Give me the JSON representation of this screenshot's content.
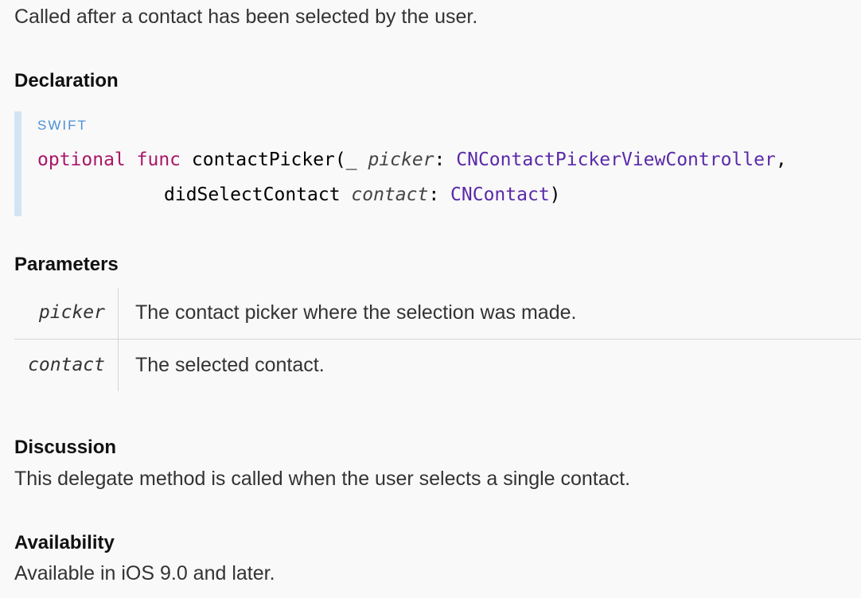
{
  "summary": "Called after a contact has been selected by the user.",
  "declaration": {
    "heading": "Declaration",
    "language": "SWIFT",
    "line1": {
      "kw_optional": "optional",
      "kw_func": "func",
      "method": "contactPicker(_ ",
      "param1": "picker",
      "colon1": ": ",
      "type1": "CNContactPickerViewController",
      "comma": ","
    },
    "line2": {
      "label": "didSelectContact ",
      "param2": "contact",
      "colon2": ": ",
      "type2": "CNContact",
      "close": ")"
    }
  },
  "parameters": {
    "heading": "Parameters",
    "rows": [
      {
        "name": "picker",
        "description": "The contact picker where the selection was made."
      },
      {
        "name": "contact",
        "description": "The selected contact."
      }
    ]
  },
  "discussion": {
    "heading": "Discussion",
    "text": "This delegate method is called when the user selects a single contact."
  },
  "availability": {
    "heading": "Availability",
    "text": "Available in iOS 9.0 and later."
  }
}
